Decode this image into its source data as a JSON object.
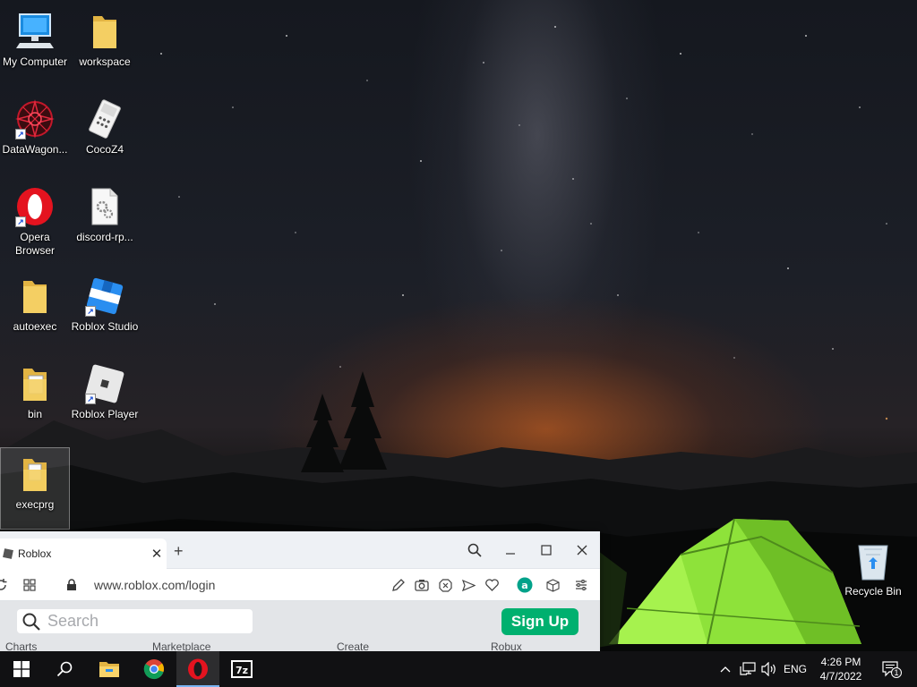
{
  "desktop": {
    "icons": [
      {
        "label": "My Computer",
        "icon": "computer-icon"
      },
      {
        "label": "workspace",
        "icon": "folder-icon"
      },
      {
        "label": "DataWagon...",
        "icon": "datawagon-icon"
      },
      {
        "label": "CocoZ4",
        "icon": "cocoz4-icon"
      },
      {
        "label": "Opera Browser",
        "icon": "opera-icon"
      },
      {
        "label": "discord-rp...",
        "icon": "settings-file-icon"
      },
      {
        "label": "autoexec",
        "icon": "folder-icon"
      },
      {
        "label": "Roblox Studio",
        "icon": "roblox-studio-icon"
      },
      {
        "label": "bin",
        "icon": "folder-icon"
      },
      {
        "label": "Roblox Player",
        "icon": "roblox-player-icon"
      },
      {
        "label": "execprg",
        "icon": "folder-icon"
      },
      {
        "label": "Recycle Bin",
        "icon": "recycle-bin-icon"
      }
    ]
  },
  "browser": {
    "tab_title": "Roblox",
    "new_tab": "+",
    "url": "www.roblox.com/login",
    "search_placeholder": "Search",
    "signup_label": "Sign Up",
    "nav_peek": [
      "Charts",
      "Marketplace",
      "Create",
      "Robux"
    ]
  },
  "taskbar": {
    "apps": [
      {
        "name": "Start",
        "icon": "windows-start-icon"
      },
      {
        "name": "Search",
        "icon": "search-icon"
      },
      {
        "name": "File Explorer",
        "icon": "file-explorer-icon"
      },
      {
        "name": "Google Chrome",
        "icon": "chrome-icon"
      },
      {
        "name": "Opera",
        "icon": "opera-icon"
      },
      {
        "name": "7-Zip",
        "icon": "7zip-icon"
      }
    ],
    "zip_label": "7z",
    "language": "ENG",
    "time": "4:26 PM",
    "date": "4/7/2022",
    "notification_count": "1"
  },
  "colors": {
    "signup_green": "#00b06f",
    "tent_green": "#8ee23a",
    "opera_red": "#e4131f",
    "roblox_blue": "#2a8ef0"
  }
}
